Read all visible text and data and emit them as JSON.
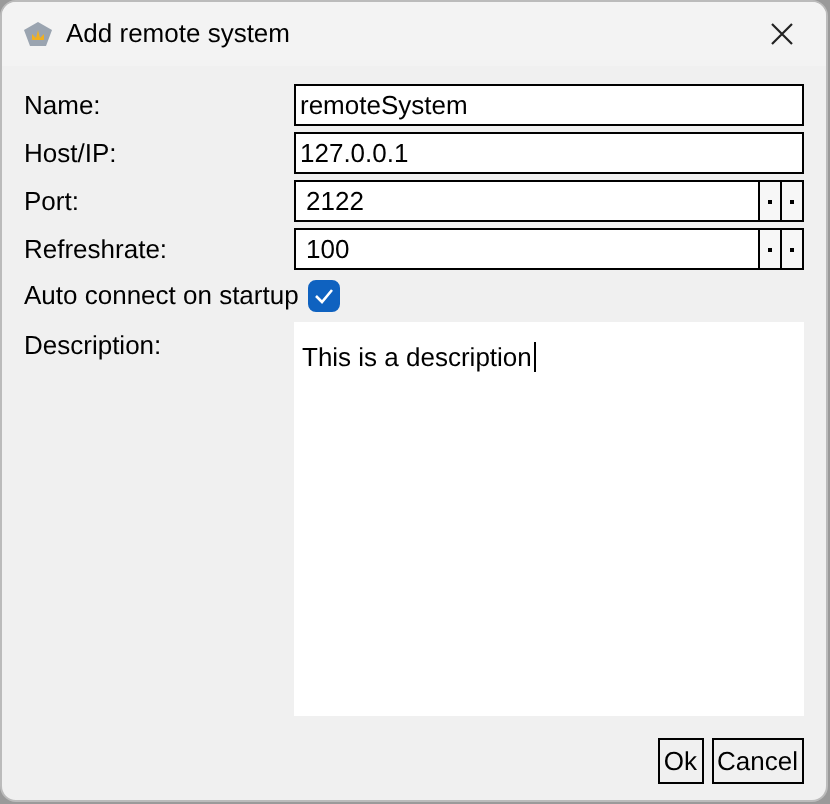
{
  "window": {
    "title": "Add remote system"
  },
  "fields": [
    {
      "kind": "text",
      "label": "Name:",
      "value": "remoteSystem"
    },
    {
      "kind": "text",
      "label": "Host/IP:",
      "value": "127.0.0.1"
    },
    {
      "kind": "spin",
      "label": "Port:",
      "value": "2122"
    },
    {
      "kind": "spin",
      "label": "Refreshrate:",
      "value": "100"
    },
    {
      "kind": "check",
      "label": "Auto connect on startup",
      "checked": true
    },
    {
      "kind": "area",
      "label": "Description:",
      "value": "This is a description"
    }
  ],
  "buttons": [
    "Ok",
    "Cancel"
  ]
}
